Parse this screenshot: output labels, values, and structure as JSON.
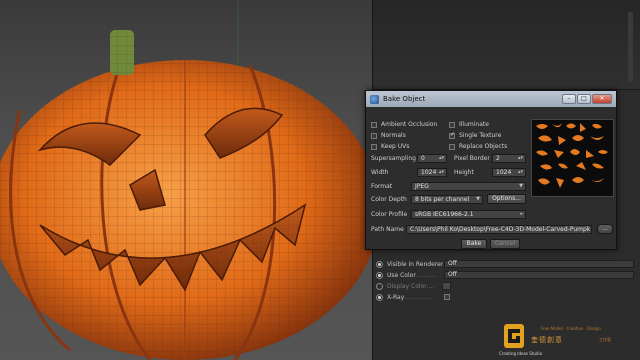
{
  "dialog": {
    "title": "Bake Object",
    "window_buttons": {
      "minimize": "–",
      "maximize": "□",
      "close": "✕"
    },
    "options": [
      {
        "label": "Ambient Occlusion",
        "checked": false
      },
      {
        "label": "Illuminate",
        "checked": false
      },
      {
        "label": "Normals",
        "checked": false
      },
      {
        "label": "Single Texture",
        "checked": true
      },
      {
        "label": "Keep UVs",
        "checked": false
      },
      {
        "label": "Replace Objects",
        "checked": false
      }
    ],
    "supersampling_label": "Supersampling",
    "supersampling_value": "0",
    "pixel_border_label": "Pixel Border",
    "pixel_border_value": "2",
    "width_label": "Width",
    "width_value": "1024",
    "height_label": "Height",
    "height_value": "1024",
    "format_label": "Format",
    "format_value": "JPEG",
    "color_depth_label": "Color Depth",
    "color_depth_value": "8 bits per channel",
    "options_button": "Options...",
    "color_profile_label": "Color Profile",
    "color_profile_value": "sRGB IEC61966-2.1",
    "path_label": "Path Name",
    "path_value": "C:\\Users\\Phil Ko\\Desktop\\Free-C4D-3D-Model-Carved-Pumpk",
    "path_browse": "...",
    "bake_button": "Bake",
    "cancel_button": "Cancel"
  },
  "attributes": [
    {
      "label": "Visible in Renderer",
      "value": "Off",
      "radio_on": true,
      "dim": false,
      "dots": "",
      "kind": "field"
    },
    {
      "label": "Use Color",
      "value": "Off",
      "radio_on": true,
      "dim": false,
      "dots": "...........",
      "kind": "field"
    },
    {
      "label": "Display Color",
      "value": "",
      "radio_on": false,
      "dim": true,
      "dots": "....",
      "kind": "swatch"
    },
    {
      "label": "X-Ray",
      "value": "",
      "radio_on": true,
      "dim": false,
      "dots": "..............",
      "kind": "check"
    }
  ],
  "watermark": {
    "brand": "奎德創意",
    "brand_sub": "工作室",
    "tagline": "Creating Ideas Studio",
    "topline": "Free Model · Creative · Design"
  },
  "colors": {
    "pumpkin": "#e3731c",
    "pumpkin_dark": "#8a3410",
    "stem": "#6f8a3a",
    "accent_orange": "#ff7a00"
  }
}
